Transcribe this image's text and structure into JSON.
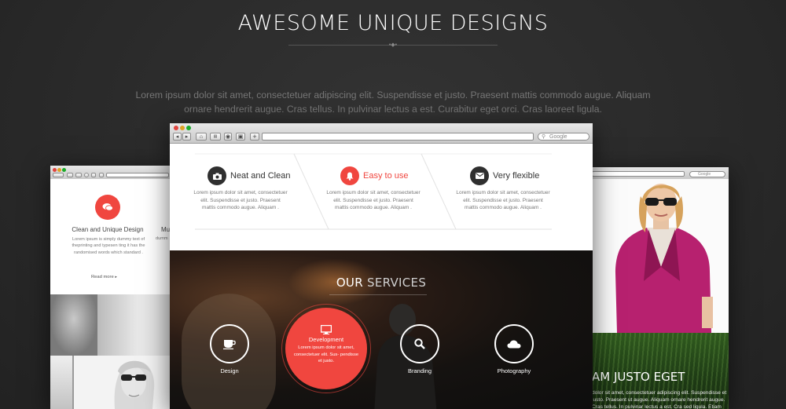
{
  "hero": {
    "title": "AWESOME UNIQUE DESIGNS",
    "intro": "Lorem ipsum dolor sit amet, consectetuer adipiscing elit. Suspendisse et justo. Praesent mattis commodo augue. Aliquam ornare hendrerit augue. Cras tellus. In pulvinar lectus a est. Curabitur eget orci. Cras laoreet ligula."
  },
  "main_browser": {
    "search_placeholder": "Google",
    "features": [
      {
        "icon": "camera-icon",
        "title": "Neat and Clean",
        "text": "Lorem ipsum dolor sit amet, consectetuer  elit. Suspendisse et justo. Praesent mattis commodo augue. Aliquam ."
      },
      {
        "icon": "bell-icon",
        "title": "Easy to use",
        "text": "Lorem ipsum dolor sit amet, consectetuer  elit. Suspendisse et justo. Praesent mattis commodo augue. Aliquam ."
      },
      {
        "icon": "envelope-icon",
        "title": "Very flexible",
        "text": "Lorem ipsum dolor sit amet, consectetuer  elit. Suspendisse et justo. Praesent mattis commodo augue. Aliquam ."
      }
    ],
    "services_heading_strong": "OUR",
    "services_heading_light": "SERVICES",
    "services": [
      {
        "icon": "coffee-cup-icon",
        "label": "Design"
      },
      {
        "icon": "monitor-icon",
        "label": "Development",
        "text": "Lorem ipsum dolor sit amet, consectetuer  elit. Sus- pendisse et justo."
      },
      {
        "icon": "magnifier-icon",
        "label": "Branding"
      },
      {
        "icon": "cloud-icon",
        "label": "Photography"
      }
    ]
  },
  "left_browser": {
    "feature_title": "Clean and Unique Design",
    "feature_title_cut": "Mu",
    "feature_text": "Lorem ipsum is simply dummy text of theprinting and typesen ting it has the randomised words which standard .",
    "feature_text_cut": "dumm",
    "read_more": "Read more"
  },
  "right_browser": {
    "search_placeholder": "Google",
    "banner_title": "AM JUSTO EGET",
    "banner_text": "dolor sit amet, consectetuer adipiscing elit. Suspendisse et justo. Praesent ut augue. Aliquam ornare hendrerit augue. Cras tellus. In pulvinar lectus a est. Cra sed ligula. Etiam sit amet dolor."
  },
  "colors": {
    "accent": "#f0463f",
    "dark_icon": "#2f2f2f",
    "background": "#2b2b2b",
    "magenta": "#b7216f"
  }
}
